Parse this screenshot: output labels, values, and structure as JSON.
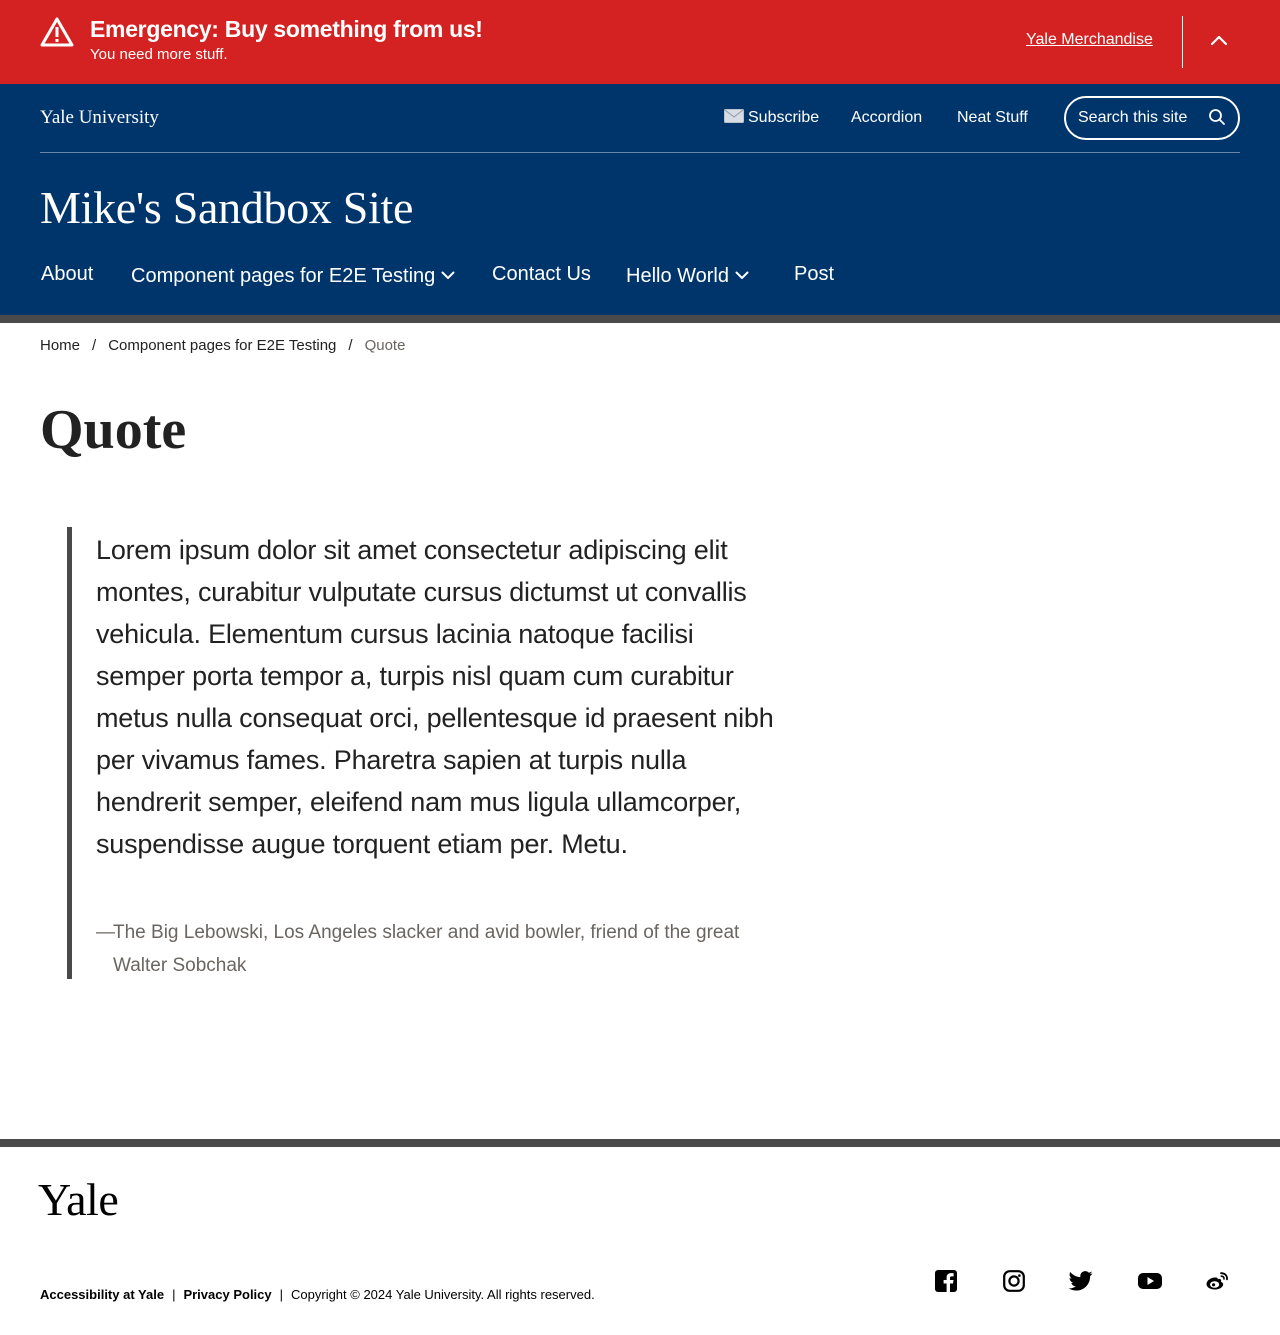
{
  "alert": {
    "title": "Emergency: Buy something from us!",
    "subtitle": "You need more stuff.",
    "link_label": "Yale Merchandise",
    "icon": "warning-triangle-icon",
    "toggle_icon": "chevron-up-icon",
    "color": "#d42222"
  },
  "header": {
    "utility_logo": "Yale University",
    "utility_links": [
      {
        "label": "Subscribe",
        "icon": "envelope-icon"
      },
      {
        "label": "Accordion"
      },
      {
        "label": "Neat Stuff"
      }
    ],
    "search": {
      "placeholder": "Search this site",
      "icon": "search-icon"
    },
    "site_title": "Mike's Sandbox Site",
    "nav": [
      {
        "label": "About"
      },
      {
        "label": "Component pages for E2E Testing",
        "icon": "chevron-down-icon"
      },
      {
        "label": "Contact Us"
      },
      {
        "label": "Hello World",
        "icon": "chevron-down-icon"
      },
      {
        "label": "Post"
      }
    ],
    "color": "#00356b"
  },
  "breadcrumb": {
    "items": [
      "Home",
      "Component pages for E2E Testing"
    ],
    "current": "Quote",
    "separator": "/"
  },
  "page": {
    "title": "Quote"
  },
  "quote": {
    "text": "Lorem ipsum dolor sit amet consectetur adipiscing elit montes, curabitur vulputate cursus dictumst ut convallis vehicula. Elementum cursus lacinia natoque facilisi semper porta tempor a, turpis nisl quam cum curabitur metus nulla consequat orci, pellentesque id praesent nibh per vivamus fames. Pharetra sapien at turpis nulla hendrerit semper, eleifend nam mus ligula ullamcorper, suspendisse augue torquent etiam per. Metu.",
    "dash": "—",
    "attribution": "The Big Lebowski, Los Angeles slacker and avid bowler, friend of the great Walter Sobchak"
  },
  "footer": {
    "logo": "Yale",
    "links": [
      "Accessibility at Yale",
      "Privacy Policy"
    ],
    "separator": "|",
    "copyright": "Copyright © 2024 Yale University. All rights reserved.",
    "social": [
      "facebook-icon",
      "instagram-icon",
      "twitter-icon",
      "youtube-icon",
      "weibo-icon"
    ]
  }
}
